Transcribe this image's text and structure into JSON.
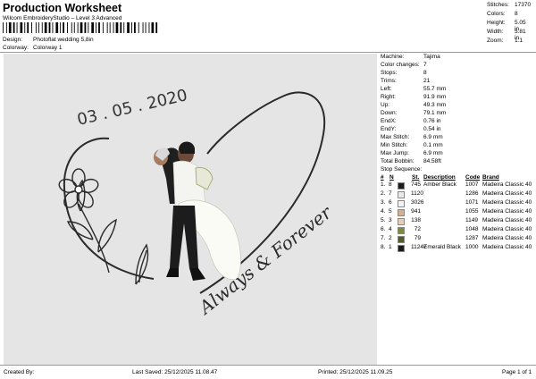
{
  "header": {
    "title": "Production Worksheet",
    "subtitle": "Wilcom EmbroideryStudio – Level 3 Advanced",
    "design_label": "Design:",
    "design_value": "Photoflat wedding 5,8in",
    "colorway_label": "Colorway:",
    "colorway_value": "Colorway 1"
  },
  "summary": [
    {
      "label": "Stitches:",
      "value": "17370"
    },
    {
      "label": "Colors:",
      "value": "8"
    },
    {
      "label": "Height:",
      "value": "5.05 in"
    },
    {
      "label": "Width:",
      "value": "5.81 in"
    },
    {
      "label": "Zoom:",
      "value": "1:1"
    }
  ],
  "design_text": {
    "date": "03 . 05 . 2020",
    "script": "Always & Forever"
  },
  "info": [
    {
      "label": "Machine:",
      "value": "Tajima"
    },
    {
      "label": "Color changes:",
      "value": "7"
    },
    {
      "label": "Stops:",
      "value": "8"
    },
    {
      "label": "Trims:",
      "value": "21"
    },
    {
      "label": "Left:",
      "value": "55.7 mm"
    },
    {
      "label": "Right:",
      "value": "91.9 mm"
    },
    {
      "label": "Up:",
      "value": "49.3 mm"
    },
    {
      "label": "Down:",
      "value": "79.1 mm"
    },
    {
      "label": "EndX:",
      "value": "0.76 in"
    },
    {
      "label": "EndY:",
      "value": "0.54 in"
    },
    {
      "label": "Max Stitch:",
      "value": "6.9 mm"
    },
    {
      "label": "Min Stitch:",
      "value": "0.1 mm"
    },
    {
      "label": "Max Jump:",
      "value": "6.9 mm"
    },
    {
      "label": "Total Bobbin:",
      "value": "84.58ft"
    }
  ],
  "stop_sequence": {
    "title": "Stop Sequence:",
    "headers": {
      "num": "#",
      "n": "N",
      "st": "St.",
      "desc": "Description",
      "code": "Code",
      "brand": "Brand"
    },
    "rows": [
      {
        "num": "1.",
        "n": "8",
        "color": "#1c1c1c",
        "st": "745",
        "desc": "Amber Black",
        "code": "1007",
        "brand": "Madeira Classic 40"
      },
      {
        "num": "2.",
        "n": "7",
        "color": "#e8e8e8",
        "st": "1120",
        "desc": "",
        "code": "1286",
        "brand": "Madeira Classic 40"
      },
      {
        "num": "3.",
        "n": "6",
        "color": "#f2f2f2",
        "st": "3026",
        "desc": "",
        "code": "1071",
        "brand": "Madeira Classic 40"
      },
      {
        "num": "4.",
        "n": "5",
        "color": "#d7ae8e",
        "st": "941",
        "desc": "",
        "code": "1055",
        "brand": "Madeira Classic 40"
      },
      {
        "num": "5.",
        "n": "3",
        "color": "#e6cdb3",
        "st": "138",
        "desc": "",
        "code": "1149",
        "brand": "Madeira Classic 40"
      },
      {
        "num": "6.",
        "n": "4",
        "color": "#7e8a3c",
        "st": "72",
        "desc": "",
        "code": "1048",
        "brand": "Madeira Classic 40"
      },
      {
        "num": "7.",
        "n": "2",
        "color": "#565a2e",
        "st": "79",
        "desc": "",
        "code": "1287",
        "brand": "Madeira Classic 40"
      },
      {
        "num": "8.",
        "n": "1",
        "color": "#1a1a1a",
        "st": "11247",
        "desc": "Emerald Black",
        "code": "1000",
        "brand": "Madeira Classic 40"
      }
    ]
  },
  "footer": {
    "created_by": "Created By:",
    "last_saved": "Last Saved: 25/12/2025 11.08.47",
    "printed": "Printed: 25/12/2025 11.09.25",
    "page": "Page 1 of 1"
  }
}
